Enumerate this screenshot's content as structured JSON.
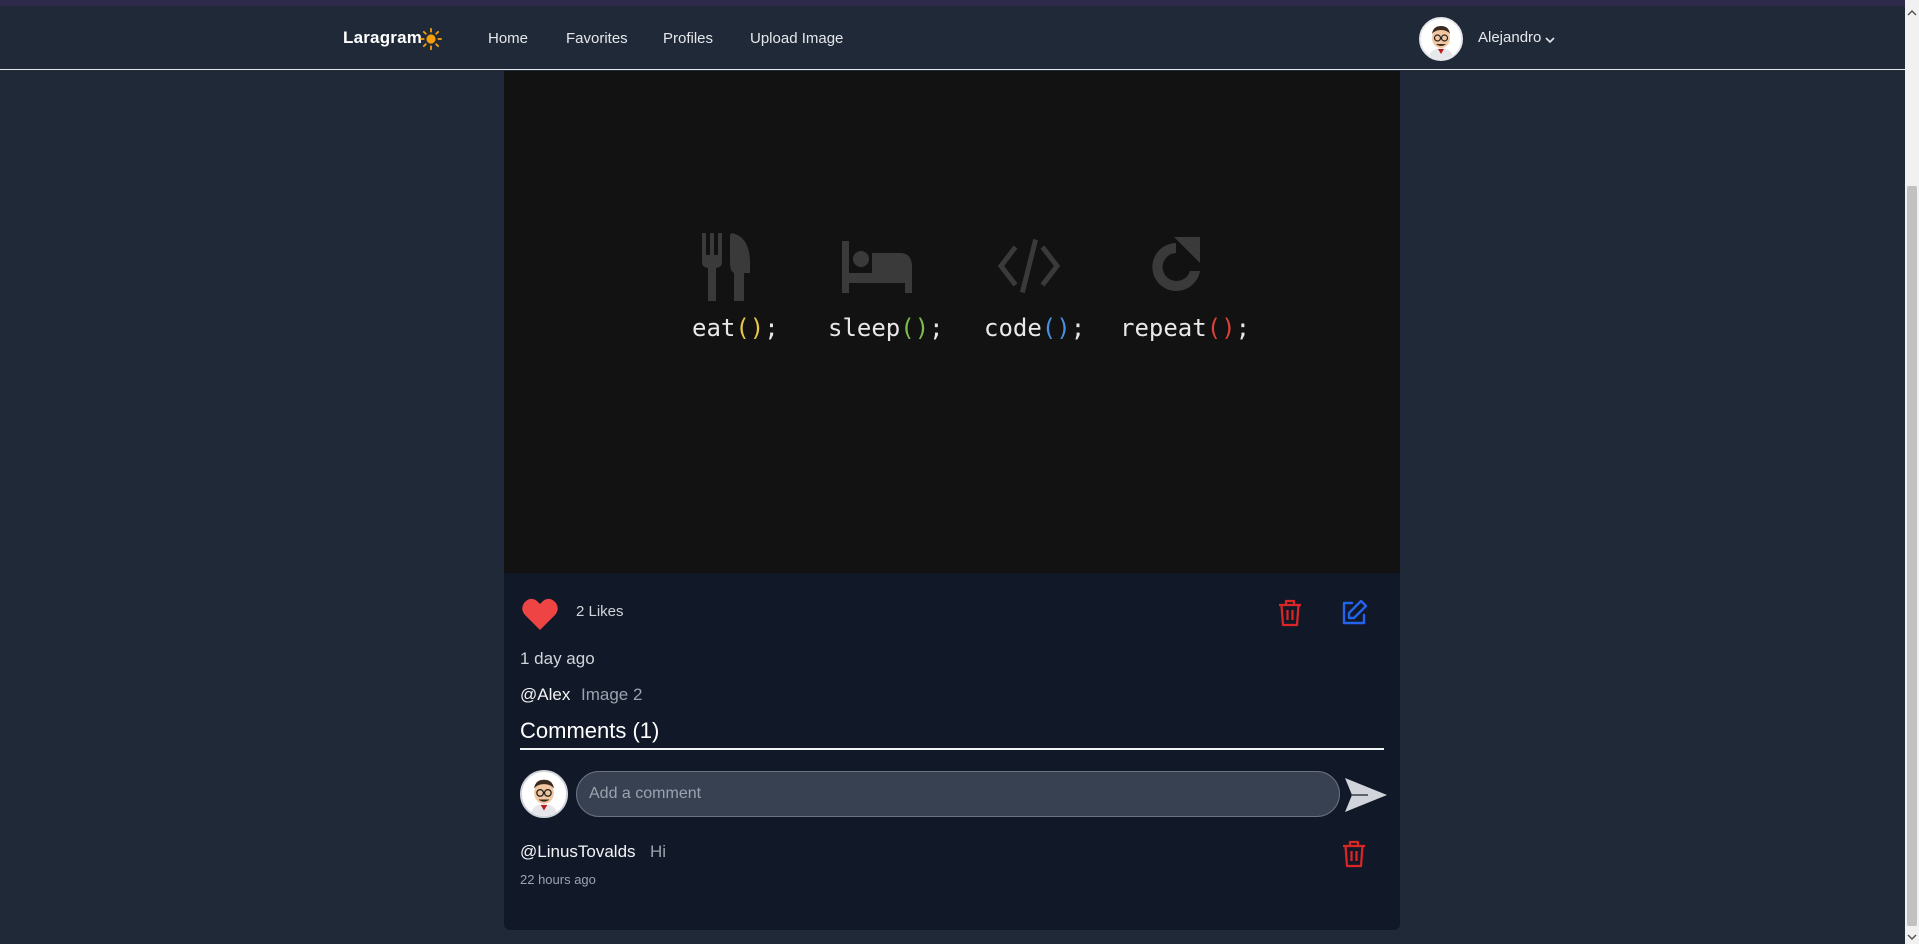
{
  "navbar": {
    "brand": "Laragram",
    "links": [
      "Home",
      "Favorites",
      "Profiles",
      "Upload Image"
    ],
    "user_name": "Alejandro"
  },
  "post": {
    "routine": [
      {
        "word": "eat",
        "paren_color": "#e6c74c",
        "icon": "fork-knife-icon"
      },
      {
        "word": "sleep",
        "paren_color": "#7bbf4a",
        "icon": "bed-icon"
      },
      {
        "word": "code",
        "paren_color": "#4a8fe0",
        "icon": "code-icon"
      },
      {
        "word": "repeat",
        "paren_color": "#d9423a",
        "icon": "repeat-icon"
      }
    ],
    "likes": "2 Likes",
    "time_ago": "1 day ago",
    "author": "@Alex",
    "caption": "Image 2",
    "comments_title": "Comments (1)",
    "comment_placeholder": "Add a comment",
    "comments": [
      {
        "user": "@LinusTovalds",
        "text": "Hi",
        "time": "22 hours ago"
      }
    ]
  },
  "colors": {
    "accent_red": "#dc2626",
    "accent_blue": "#2563eb",
    "background": "#1f2937"
  }
}
